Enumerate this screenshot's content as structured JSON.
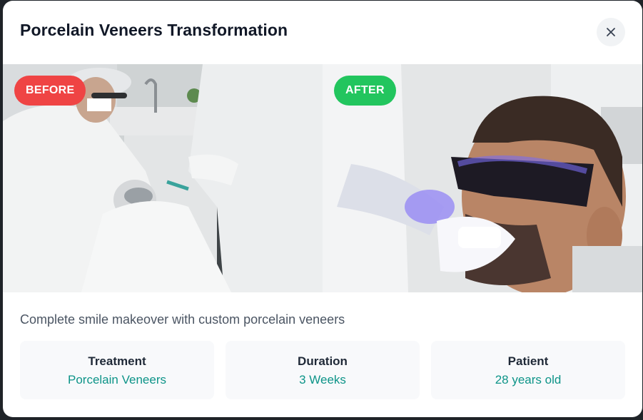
{
  "modal": {
    "title": "Porcelain Veneers Transformation",
    "close_icon": "close-icon"
  },
  "photos": {
    "before": {
      "badge": "BEFORE",
      "badge_color": "#ef4444"
    },
    "after": {
      "badge": "AFTER",
      "badge_color": "#22c55e"
    }
  },
  "description": "Complete smile makeover with custom porcelain veneers",
  "stats": [
    {
      "label": "Treatment",
      "value": "Porcelain Veneers"
    },
    {
      "label": "Duration",
      "value": "3 Weeks"
    },
    {
      "label": "Patient",
      "value": "28 years old"
    }
  ],
  "colors": {
    "accent": "#0d9488",
    "before_badge": "#ef4444",
    "after_badge": "#22c55e"
  }
}
